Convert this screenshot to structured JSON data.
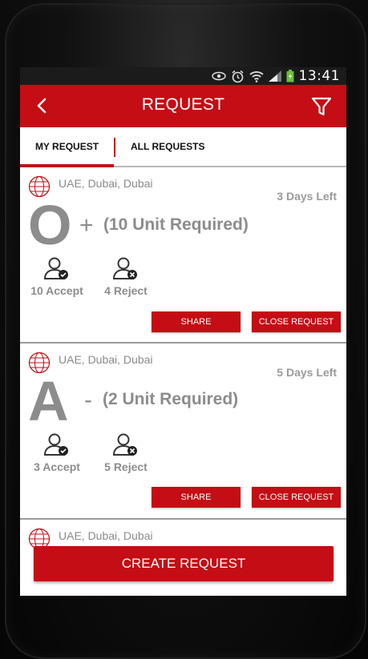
{
  "status_bar": {
    "time": "13:41"
  },
  "app_bar": {
    "title": "REQUEST"
  },
  "tabs": [
    {
      "label": "MY REQUEST",
      "active": true
    },
    {
      "label": "ALL REQUESTS",
      "active": false
    }
  ],
  "requests": [
    {
      "location": "UAE, Dubai, Dubai",
      "days_left": "3 Days Left",
      "blood_group": "O",
      "rh": "+",
      "units": "(10 Unit Required)",
      "accept": "10 Accept",
      "reject": "4 Reject",
      "share_label": "SHARE",
      "close_label": "CLOSE REQUEST"
    },
    {
      "location": "UAE, Dubai, Dubai",
      "days_left": "5 Days Left",
      "blood_group": "A",
      "rh": "-",
      "units": "(2 Unit Required)",
      "accept": "3 Accept",
      "reject": "5 Reject",
      "share_label": "SHARE",
      "close_label": "CLOSE REQUEST"
    },
    {
      "location": "UAE, Dubai, Dubai"
    }
  ],
  "footer": {
    "create_label": "CREATE REQUEST"
  },
  "colors": {
    "accent": "#c40d14",
    "text_muted": "#8c8c8c",
    "status_bar": "#1b1b1b"
  },
  "icons": [
    "eye-icon",
    "alarm-icon",
    "wifi-icon",
    "signal-icon",
    "battery-icon",
    "back-arrow-icon",
    "filter-icon",
    "globe-icon",
    "user-accept-icon",
    "user-reject-icon"
  ]
}
